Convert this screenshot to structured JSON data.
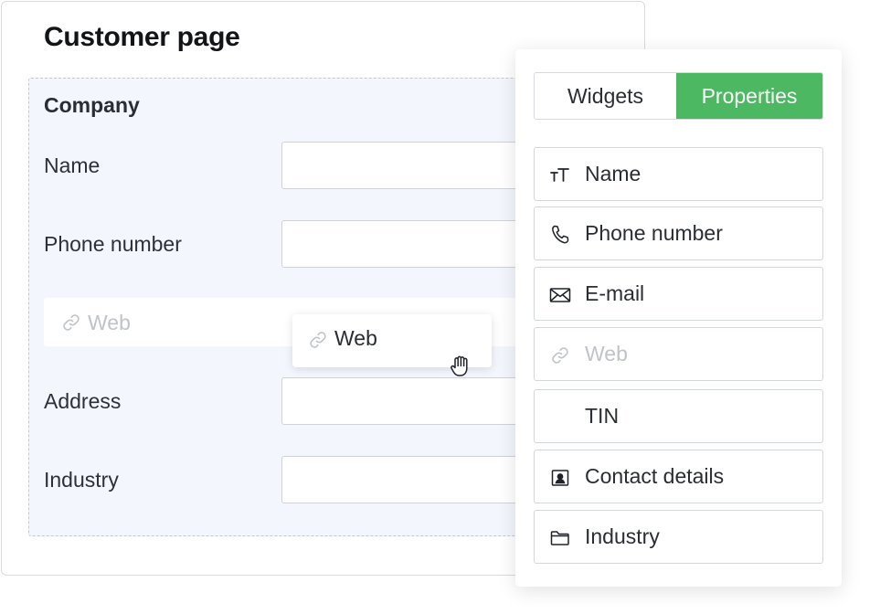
{
  "page": {
    "title": "Customer page",
    "section_title": "Company",
    "fields": [
      {
        "label": "Name",
        "value": ""
      },
      {
        "label": "Phone number",
        "value": ""
      },
      {
        "label": "Address",
        "value": ""
      },
      {
        "label": "Industry",
        "value": ""
      }
    ],
    "drop_placeholder_label": "Web",
    "dragged_widget_label": "Web"
  },
  "panel": {
    "tabs": [
      {
        "label": "Widgets",
        "active": false
      },
      {
        "label": "Properties",
        "active": true
      }
    ],
    "properties": [
      {
        "label": "Name",
        "icon": "text-icon",
        "enabled": true
      },
      {
        "label": "Phone number",
        "icon": "phone-icon",
        "enabled": true
      },
      {
        "label": "E-mail",
        "icon": "envelope-icon",
        "enabled": true
      },
      {
        "label": "Web",
        "icon": "link-icon",
        "enabled": false
      },
      {
        "label": "TIN",
        "icon": "",
        "enabled": true
      },
      {
        "label": "Contact details",
        "icon": "contact-card-icon",
        "enabled": true
      },
      {
        "label": "Industry",
        "icon": "folder-icon",
        "enabled": true
      }
    ]
  },
  "colors": {
    "accent": "#4cb862",
    "section_bg": "#f3f7fd",
    "disabled_text": "#c0c4c9"
  }
}
